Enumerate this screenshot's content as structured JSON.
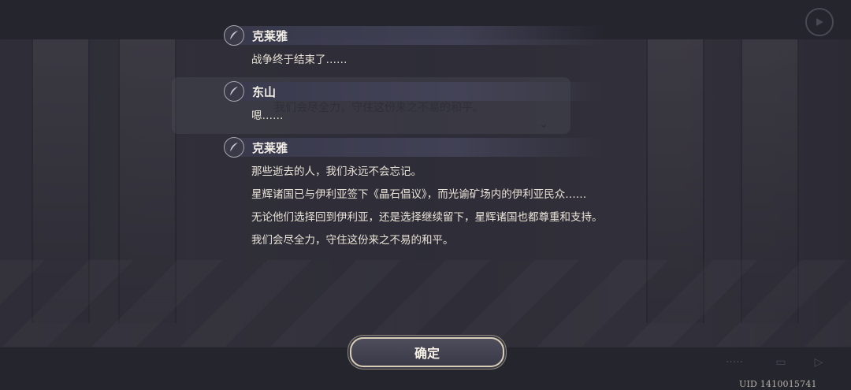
{
  "colors": {
    "background": "#2c2c36",
    "text_primary": "#e8e2d6",
    "speaker_bar": "#3a3a4e",
    "button_border": "#d8cfb6"
  },
  "log": {
    "entries": [
      {
        "speaker": "克莱雅",
        "icon": "quill-icon",
        "lines": [
          "战争终于结束了……"
        ]
      },
      {
        "speaker": "东山",
        "icon": "quill-icon",
        "lines": [
          "嗯……"
        ]
      },
      {
        "speaker": "克莱雅",
        "icon": "quill-icon",
        "lines": [
          "那些逝去的人，我们永远不会忘记。",
          "星辉诸国已与伊利亚签下《晶石倡议》，而光谕矿场内的伊利亚民众……",
          "无论他们选择回到伊利亚，还是选择继续留下，星辉诸国也都尊重和支持。",
          "我们会尽全力，守住这份来之不易的和平。"
        ]
      }
    ]
  },
  "background_dialog": {
    "text": "我们会尽全力，守住这份来之不易的和平。",
    "chevron": "chevron-down-icon"
  },
  "buttons": {
    "confirm_label": "确定"
  },
  "footer": {
    "uid": "UID 1410015741"
  }
}
